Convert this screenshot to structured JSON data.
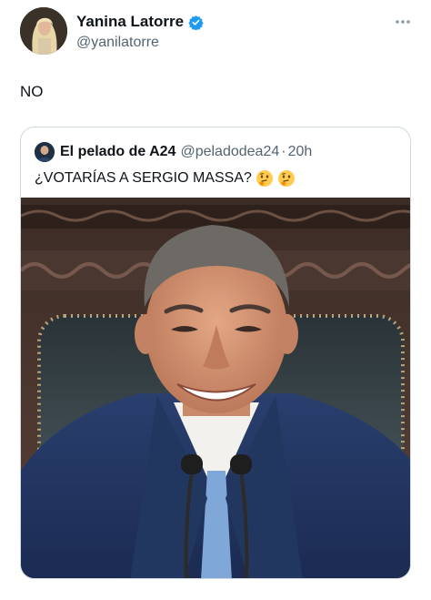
{
  "tweet": {
    "display_name": "Yanina Latorre",
    "handle": "@yanilatorre",
    "text": "NO",
    "more_icon": "more-horizontal-icon"
  },
  "quoted": {
    "display_name": "El pelado de A24",
    "handle": "@peladodea24",
    "separator": "·",
    "time": "20h",
    "text": "¿VOTARÍAS A SERGIO MASSA?",
    "emoji": [
      "thinking-face-emoji",
      "thinking-face-emoji"
    ]
  },
  "colors": {
    "verified": "#1d9bf0",
    "secondary_text": "#536471",
    "border": "#cfd9de"
  }
}
